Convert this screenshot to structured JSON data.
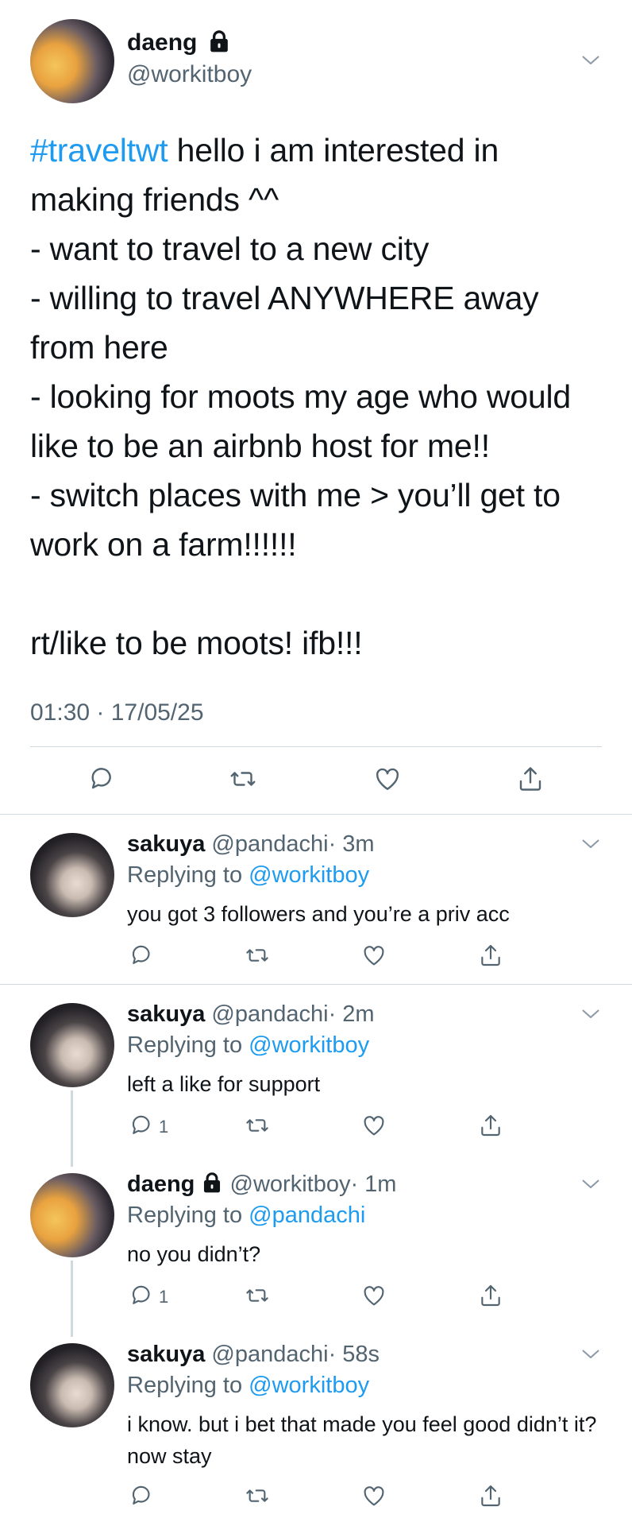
{
  "main_tweet": {
    "author_name": "daeng",
    "author_handle": "@workitboy",
    "hashtag": "#traveltwt",
    "body": " hello i am interested in making friends ^^\n- want to travel to a new city\n- willing to travel ANYWHERE away from here\n- looking for moots my age who would like to be an airbnb host for me!!\n- switch places with me > you’ll get to work on a farm!!!!!!\n\nrt/like to be moots! ifb!!!",
    "timestamp": "01:30 · 17/05/25"
  },
  "replies": [
    {
      "name": "sakuya",
      "handle": "@pandachi",
      "time": "· 3m",
      "replying_prefix": "Replying to ",
      "replying_to": "@workitboy",
      "text": "you got 3 followers and you’re a priv acc",
      "reply_count": ""
    },
    {
      "name": "sakuya",
      "handle": "@pandachi",
      "time": "· 2m",
      "replying_prefix": "Replying to ",
      "replying_to": "@workitboy",
      "text": "left a like for support",
      "reply_count": "1"
    },
    {
      "name": "daeng",
      "handle": "@workitboy",
      "time": "· 1m",
      "replying_prefix": "Replying to ",
      "replying_to": "@pandachi",
      "text": "no you didn’t?",
      "reply_count": "1"
    },
    {
      "name": "sakuya",
      "handle": "@pandachi",
      "time": "· 58s",
      "replying_prefix": "Replying to ",
      "replying_to": "@workitboy",
      "text": "i know. but i bet that made you feel good didn’t it? now stay",
      "reply_count": ""
    }
  ],
  "icons": {
    "reply": "reply-icon",
    "retweet": "retweet-icon",
    "like": "like-icon",
    "share": "share-icon",
    "lock": "lock-icon",
    "more": "chevron-down-icon"
  },
  "colors": {
    "link": "#1d9bf0",
    "secondary_text": "#536471",
    "divider": "#cfd9de"
  }
}
